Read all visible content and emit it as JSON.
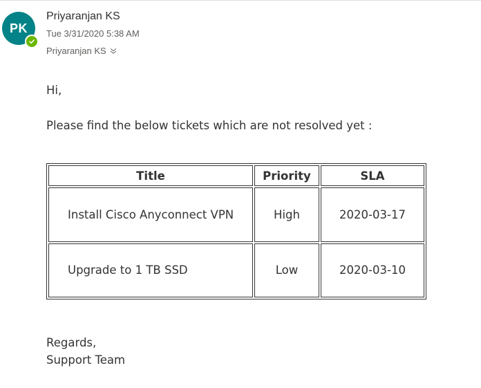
{
  "header": {
    "avatar_initials": "PK",
    "sender_name": "Priyaranjan KS",
    "timestamp": "Tue 3/31/2020 5:38 AM",
    "recipient": "Priyaranjan KS",
    "presence_status": "available",
    "avatar_color": "#038387",
    "presence_color": "#6bb700"
  },
  "message": {
    "greeting": "Hi,",
    "intro": "Please find the below tickets which are not resolved yet :",
    "table": {
      "headers": [
        "Title",
        "Priority",
        "SLA"
      ],
      "rows": [
        [
          "Install Cisco Anyconnect VPN",
          "High",
          "2020-03-17"
        ],
        [
          "Upgrade to 1 TB SSD",
          "Low",
          "2020-03-10"
        ]
      ]
    },
    "signoff": "Regards,",
    "signature": "Support Team"
  }
}
